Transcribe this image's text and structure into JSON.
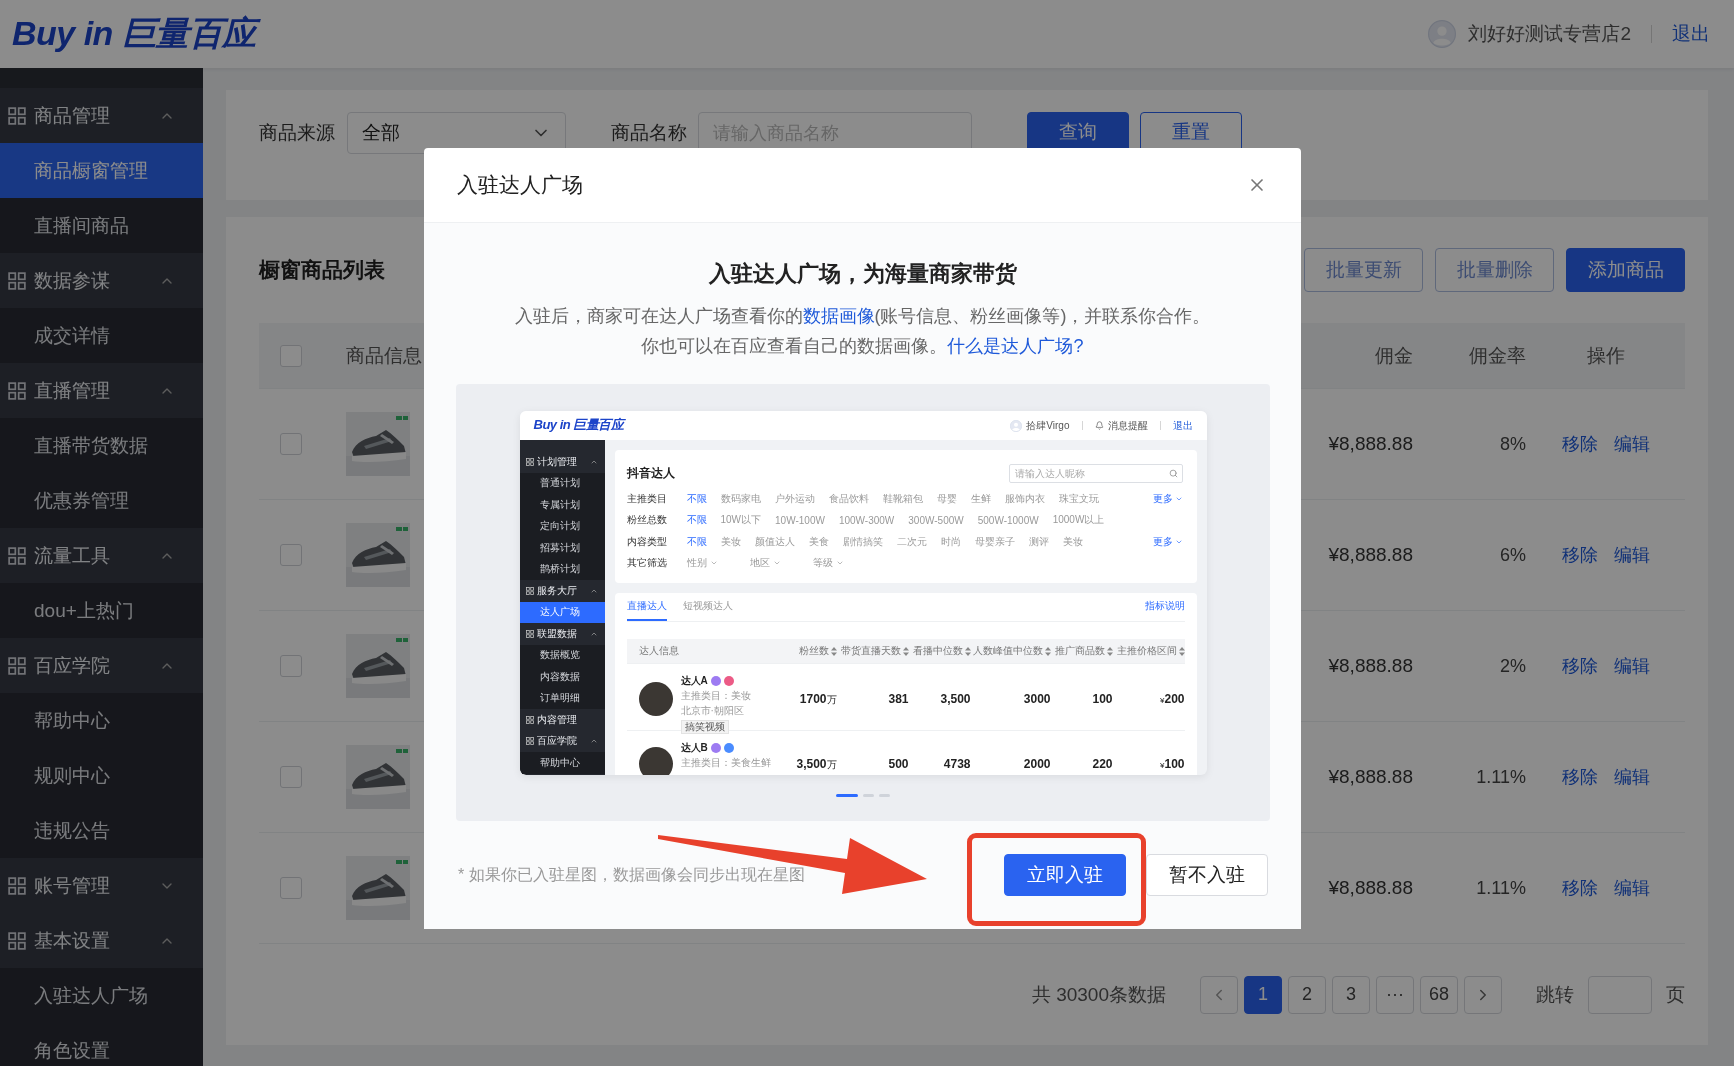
{
  "header": {
    "logo": {
      "latin": "Buy in",
      "cjk": "巨量百应"
    },
    "account": "刘好好测试专营店2",
    "logout": "退出"
  },
  "sidebar": [
    {
      "label": "商品管理",
      "expanded": true,
      "children": [
        {
          "label": "商品橱窗管理",
          "selected": true
        },
        {
          "label": "直播间商品",
          "selected": false
        }
      ]
    },
    {
      "label": "数据参谋",
      "expanded": true,
      "children": [
        {
          "label": "成交详情",
          "selected": false
        }
      ]
    },
    {
      "label": "直播管理",
      "expanded": true,
      "children": [
        {
          "label": "直播带货数据",
          "selected": false
        },
        {
          "label": "优惠券管理",
          "selected": false
        }
      ]
    },
    {
      "label": "流量工具",
      "expanded": true,
      "children": [
        {
          "label": "dou+上热门",
          "selected": false
        }
      ]
    },
    {
      "label": "百应学院",
      "expanded": true,
      "children": [
        {
          "label": "帮助中心",
          "selected": false
        },
        {
          "label": "规则中心",
          "selected": false
        },
        {
          "label": "违规公告",
          "selected": false
        }
      ]
    },
    {
      "label": "账号管理",
      "expanded": false
    },
    {
      "label": "基本设置",
      "expanded": true,
      "children": [
        {
          "label": "入驻达人广场",
          "selected": false
        },
        {
          "label": "角色设置",
          "selected": false
        }
      ]
    }
  ],
  "filters": {
    "source": {
      "label": "商品来源",
      "value": "全部"
    },
    "name": {
      "label": "商品名称",
      "placeholder": "请输入商品名称"
    },
    "buttons": [
      {
        "label": "查询",
        "primary": true
      },
      {
        "label": "重置",
        "primary": false
      }
    ]
  },
  "product_list": {
    "title": "橱窗商品列表",
    "actions": [
      {
        "label": "批量更新",
        "primary": false
      },
      {
        "label": "批量删除",
        "primary": false
      },
      {
        "label": "添加商品",
        "primary": true
      }
    ],
    "columns": {
      "info": "商品信息",
      "commission": "佣金",
      "rate": "佣金率",
      "actions": "操作"
    },
    "select_all": {
      "checked": false
    },
    "rows": [
      {
        "checked": false,
        "commission": "¥8,888.88",
        "rate": "8%",
        "actions": [
          "移除",
          "编辑"
        ]
      },
      {
        "checked": false,
        "commission": "¥8,888.88",
        "rate": "6%",
        "actions": [
          "移除",
          "编辑"
        ]
      },
      {
        "checked": false,
        "commission": "¥8,888.88",
        "rate": "2%",
        "actions": [
          "移除",
          "编辑"
        ]
      },
      {
        "checked": false,
        "commission": "¥8,888.88",
        "rate": "1.11%",
        "actions": [
          "移除",
          "编辑"
        ]
      },
      {
        "checked": false,
        "commission": "¥8,888.88",
        "rate": "1.11%",
        "actions": [
          "移除",
          "编辑"
        ]
      }
    ]
  },
  "pagination": {
    "total": "共 30300条数据",
    "pages": [
      {
        "label": "1",
        "selected": true
      },
      {
        "label": "2",
        "selected": false
      },
      {
        "label": "3",
        "selected": false
      },
      {
        "label": "···",
        "selected": false
      },
      {
        "label": "68",
        "selected": false
      }
    ],
    "jump_label": "跳转",
    "page_unit": "页"
  },
  "modal": {
    "title": "入驻达人广场",
    "heading": "入驻达人广场，为海量商家带货",
    "intro": [
      [
        {
          "kind": "text",
          "text": "入驻后，商家可在达人广场查看你的"
        },
        {
          "kind": "link",
          "text": "数据画像"
        },
        {
          "kind": "text",
          "text": "(账号信息、粉丝画像等)，并联系你合作。"
        }
      ],
      [
        {
          "kind": "text",
          "text": "你也可以在百应查看自己的数据画像。"
        },
        {
          "kind": "link",
          "text": "什么是达人广场?"
        }
      ]
    ],
    "preview": {
      "header": {
        "logo": {
          "latin": "Buy in",
          "cjk": "巨量百应"
        },
        "user": "拾肆Virgo",
        "notifications": "消息提醒",
        "logout": "退出"
      },
      "sidebar": [
        {
          "label": "计划管理",
          "expanded": true,
          "children": [
            {
              "label": "普通计划",
              "selected": false
            },
            {
              "label": "专属计划",
              "selected": false
            },
            {
              "label": "定向计划",
              "selected": false
            },
            {
              "label": "招募计划",
              "selected": false
            },
            {
              "label": "鹊桥计划",
              "selected": false
            }
          ]
        },
        {
          "label": "服务大厅",
          "expanded": true,
          "children": [
            {
              "label": "达人广场",
              "selected": true
            }
          ]
        },
        {
          "label": "联盟数据",
          "expanded": true,
          "children": [
            {
              "label": "数据概览",
              "selected": false
            },
            {
              "label": "内容数据",
              "selected": false
            },
            {
              "label": "订单明细",
              "selected": false
            }
          ]
        },
        {
          "label": "内容管理"
        },
        {
          "label": "百应学院",
          "expanded": true,
          "children": [
            {
              "label": "帮助中心",
              "selected": false
            }
          ]
        }
      ],
      "title": "抖音达人",
      "search_placeholder": "请输入达人昵称",
      "filters": [
        {
          "kind": "options",
          "label": "主推类目",
          "options": [
            {
              "label": "不限",
              "selected": true
            },
            {
              "label": "数码家电",
              "selected": false
            },
            {
              "label": "户外运动",
              "selected": false
            },
            {
              "label": "食品饮料",
              "selected": false
            },
            {
              "label": "鞋靴箱包",
              "selected": false
            },
            {
              "label": "母婴",
              "selected": false
            },
            {
              "label": "生鲜",
              "selected": false
            },
            {
              "label": "服饰内衣",
              "selected": false
            },
            {
              "label": "珠宝文玩",
              "selected": false
            }
          ],
          "more": "更多"
        },
        {
          "kind": "options",
          "label": "粉丝总数",
          "options": [
            {
              "label": "不限",
              "selected": true
            },
            {
              "label": "10W以下",
              "selected": false
            },
            {
              "label": "10W-100W",
              "selected": false
            },
            {
              "label": "100W-300W",
              "selected": false
            },
            {
              "label": "300W-500W",
              "selected": false
            },
            {
              "label": "500W-1000W",
              "selected": false
            },
            {
              "label": "1000W以上",
              "selected": false
            }
          ]
        },
        {
          "kind": "options",
          "label": "内容类型",
          "options": [
            {
              "label": "不限",
              "selected": true
            },
            {
              "label": "美妆",
              "selected": false
            },
            {
              "label": "颜值达人",
              "selected": false
            },
            {
              "label": "美食",
              "selected": false
            },
            {
              "label": "剧情搞笑",
              "selected": false
            },
            {
              "label": "二次元",
              "selected": false
            },
            {
              "label": "时尚",
              "selected": false
            },
            {
              "label": "母婴亲子",
              "selected": false
            },
            {
              "label": "测评",
              "selected": false
            },
            {
              "label": "美妆",
              "selected": false
            }
          ],
          "more": "更多"
        },
        {
          "kind": "dropdowns",
          "label": "其它筛选",
          "dropdowns": [
            "性别",
            "地区",
            "等级"
          ]
        }
      ],
      "tabs": [
        {
          "label": "直播达人",
          "selected": true
        },
        {
          "label": "短视频达人",
          "selected": false
        }
      ],
      "help_link": "指标说明",
      "columns": [
        {
          "label": "达人信息",
          "sortable": false
        },
        {
          "label": "粉丝数",
          "sortable": true
        },
        {
          "label": "带货直播天数",
          "sortable": true
        },
        {
          "label": "看播中位数",
          "sortable": true
        },
        {
          "label": "人数峰值中位数",
          "sortable": true
        },
        {
          "label": "推广商品数",
          "sortable": true
        },
        {
          "label": "主推价格区间",
          "sortable": true
        }
      ],
      "rows": [
        {
          "name": "达人A",
          "badges": [
            {
              "color": "#9d7bf2"
            },
            {
              "color": "#ec5b86"
            }
          ],
          "category": "主推类目：美妆",
          "location": "北京市·朝阳区",
          "tag": "搞笑视频",
          "fans": "1700",
          "fans_unit": "万",
          "days": "381",
          "views": "3,500",
          "peak": "3000",
          "products": "100",
          "currency": "¥",
          "price": "200"
        },
        {
          "name": "达人B",
          "badges": [
            {
              "color": "#9d7bf2"
            },
            {
              "color": "#4a8cff"
            }
          ],
          "category": "主推类目：美食生鲜",
          "fans": "3,500",
          "fans_unit": "万",
          "days": "500",
          "views": "4738",
          "peak": "2000",
          "products": "220",
          "currency": "¥",
          "price": "100"
        }
      ]
    },
    "slides": [
      {
        "selected": true
      },
      {
        "selected": false
      },
      {
        "selected": false
      }
    ],
    "note": "* 如果你已入驻星图，数据画像会同步出现在星图",
    "buttons": [
      {
        "label": "立即入驻",
        "primary": true,
        "highlighted": true
      },
      {
        "label": "暂不入驻",
        "primary": false,
        "highlighted": false
      }
    ]
  }
}
